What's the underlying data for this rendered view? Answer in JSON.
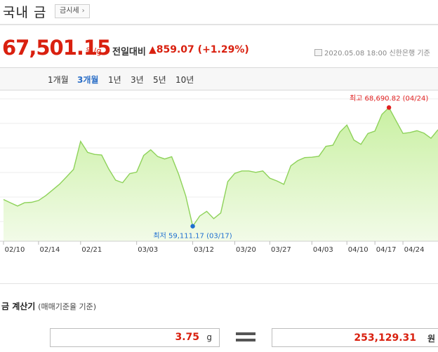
{
  "header": {
    "title": "국내 금",
    "category_tag": "금시세"
  },
  "quote": {
    "price": "67,501.15",
    "unit": "원/g",
    "prev_label": "전일대비",
    "change": "▲859.07 (+1.29%)",
    "date": "2020.05.08 18:00",
    "source": "신한은행 기준"
  },
  "period_tabs": [
    {
      "label": "1개월",
      "active": false
    },
    {
      "label": "3개월",
      "active": true
    },
    {
      "label": "1년",
      "active": false
    },
    {
      "label": "3년",
      "active": false
    },
    {
      "label": "5년",
      "active": false
    },
    {
      "label": "10년",
      "active": false
    }
  ],
  "chart_data": {
    "type": "area",
    "x_ticks": [
      "02/10",
      "02/14",
      "02/21",
      "03/03",
      "03/12",
      "03/20",
      "03/27",
      "04/03",
      "04/10",
      "04/17",
      "04/24"
    ],
    "annotations": {
      "max": "최고 68,690.82 (04/24)",
      "min": "최저 59,111.17 (03/17)"
    },
    "series": [
      {
        "values": [
          61.27,
          61.0,
          60.74,
          61.01,
          61.04,
          61.19,
          61.57,
          62.04,
          62.51,
          63.1,
          63.7,
          65.96,
          65.07,
          64.91,
          64.86,
          63.74,
          62.83,
          62.62,
          63.35,
          63.48,
          64.82,
          65.28,
          64.74,
          64.54,
          64.72,
          63.29,
          61.56,
          59.11,
          59.93,
          60.31,
          59.72,
          60.18,
          62.71,
          63.38,
          63.57,
          63.57,
          63.46,
          63.57,
          62.99,
          62.77,
          62.49,
          63.99,
          64.41,
          64.65,
          64.68,
          64.76,
          65.56,
          65.65,
          66.71,
          67.28,
          66.07,
          65.72,
          66.6,
          66.79,
          68.14,
          68.69,
          67.64,
          66.6,
          66.68,
          66.82,
          66.62,
          66.21,
          66.9
        ]
      }
    ],
    "ylim": [
      57.9,
      69.9
    ],
    "y_unit": "thousand 원/g",
    "colors": {
      "line": "#8ed25a",
      "fill_top": "#c9f0a2",
      "fill_bottom": "#f2fbe8",
      "max": "#e02020",
      "min": "#1e6fd0"
    }
  },
  "calculator": {
    "title": "금 계산기",
    "subtitle": "(매매기준율 기준)",
    "gram_value": "3.75",
    "gram_unit": "g",
    "won_value": "253,129.31",
    "won_unit": "원"
  }
}
